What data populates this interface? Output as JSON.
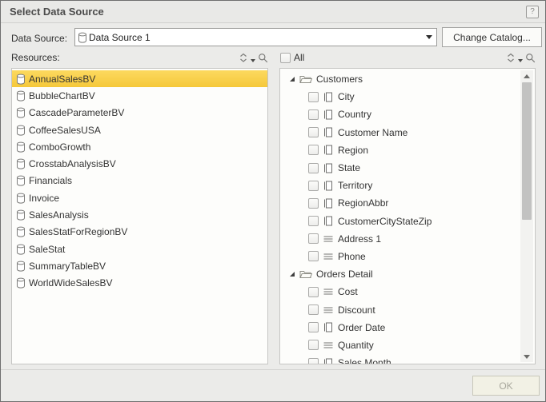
{
  "dialog": {
    "title": "Select Data Source",
    "help_label": "?",
    "data_source_label": "Data Source:",
    "data_source_value": "Data Source 1",
    "change_catalog_label": "Change Catalog...",
    "ok_label": "OK",
    "ok_enabled": false
  },
  "resources": {
    "label": "Resources:",
    "items": [
      {
        "name": "AnnualSalesBV",
        "selected": true
      },
      {
        "name": "BubbleChartBV",
        "selected": false
      },
      {
        "name": "CascadeParameterBV",
        "selected": false
      },
      {
        "name": "CoffeeSalesUSA",
        "selected": false
      },
      {
        "name": "ComboGrowth",
        "selected": false
      },
      {
        "name": "CrosstabAnalysisBV",
        "selected": false
      },
      {
        "name": "Financials",
        "selected": false
      },
      {
        "name": "Invoice",
        "selected": false
      },
      {
        "name": "SalesAnalysis",
        "selected": false
      },
      {
        "name": "SalesStatForRegionBV",
        "selected": false
      },
      {
        "name": "SaleStat",
        "selected": false
      },
      {
        "name": "SummaryTableBV",
        "selected": false
      },
      {
        "name": "WorldWideSalesBV",
        "selected": false
      }
    ]
  },
  "fields": {
    "all_label": "All",
    "all_checked": false,
    "groups": [
      {
        "label": "Customers",
        "expanded": true,
        "items": [
          {
            "label": "City",
            "icon": "column",
            "checked": false
          },
          {
            "label": "Country",
            "icon": "column",
            "checked": false
          },
          {
            "label": "Customer Name",
            "icon": "column",
            "checked": false
          },
          {
            "label": "Region",
            "icon": "column",
            "checked": false
          },
          {
            "label": "State",
            "icon": "column",
            "checked": false
          },
          {
            "label": "Territory",
            "icon": "column",
            "checked": false
          },
          {
            "label": "RegionAbbr",
            "icon": "column",
            "checked": false
          },
          {
            "label": "CustomerCityStateZip",
            "icon": "column",
            "checked": false
          },
          {
            "label": "Address 1",
            "icon": "formula",
            "checked": false
          },
          {
            "label": "Phone",
            "icon": "formula",
            "checked": false
          }
        ]
      },
      {
        "label": "Orders Detail",
        "expanded": true,
        "items": [
          {
            "label": "Cost",
            "icon": "formula",
            "checked": false
          },
          {
            "label": "Discount",
            "icon": "formula",
            "checked": false
          },
          {
            "label": "Order Date",
            "icon": "column",
            "checked": false
          },
          {
            "label": "Quantity",
            "icon": "formula",
            "checked": false
          },
          {
            "label": "Sales Month",
            "icon": "column",
            "checked": false
          }
        ]
      }
    ]
  },
  "colors": {
    "selection_yellow": "#F8CD49",
    "dialog_bg": "#EBEBE9",
    "list_bg": "#FDFDFB",
    "title_text": "#4B4B4B",
    "disabled_text": "#A8A79C"
  }
}
